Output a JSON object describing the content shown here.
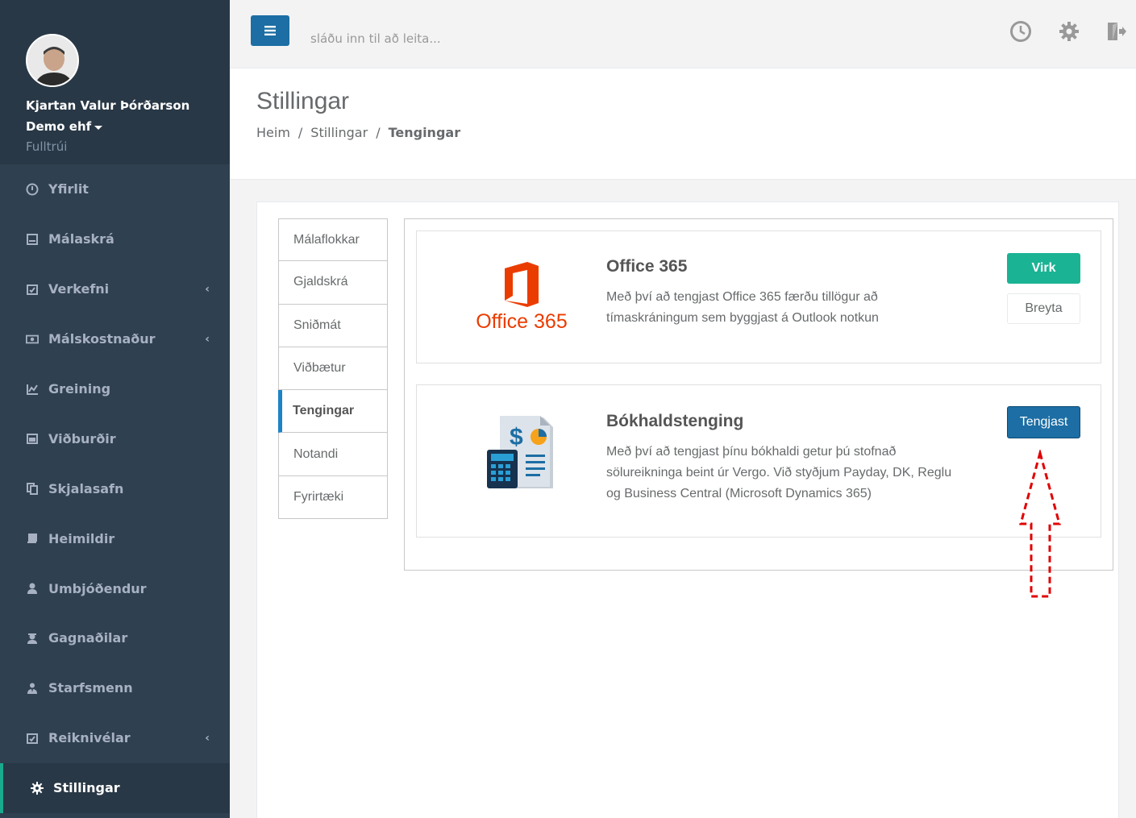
{
  "profile": {
    "name": "Kjartan Valur Þórðarson",
    "company": "Demo ehf",
    "role": "Fulltrúi"
  },
  "sidebar": {
    "items": [
      {
        "label": "Yfirlit",
        "icon": "dashboard-icon",
        "submenu": false
      },
      {
        "label": "Málaskrá",
        "icon": "archive-icon",
        "submenu": false
      },
      {
        "label": "Verkefni",
        "icon": "calendar-check-icon",
        "submenu": true
      },
      {
        "label": "Málskostnaður",
        "icon": "money-icon",
        "submenu": true
      },
      {
        "label": "Greining",
        "icon": "line-chart-icon",
        "submenu": false
      },
      {
        "label": "Viðburðir",
        "icon": "calendar-icon",
        "submenu": false
      },
      {
        "label": "Skjalasafn",
        "icon": "files-icon",
        "submenu": false
      },
      {
        "label": "Heimildir",
        "icon": "book-icon",
        "submenu": false
      },
      {
        "label": "Umbjóðendur",
        "icon": "user-icon",
        "submenu": false
      },
      {
        "label": "Gagnaðilar",
        "icon": "user-secret-icon",
        "submenu": false
      },
      {
        "label": "Starfsmenn",
        "icon": "user-tie-icon",
        "submenu": false
      },
      {
        "label": "Reiknivélar",
        "icon": "calendar-check-icon",
        "submenu": true
      },
      {
        "label": "Stillingar",
        "icon": "gear-icon",
        "submenu": false,
        "active": true
      }
    ]
  },
  "topbar": {
    "search_placeholder": "sláðu inn til að leita..."
  },
  "page": {
    "title": "Stillingar",
    "breadcrumb": [
      "Heim",
      "Stillingar",
      "Tengingar"
    ]
  },
  "tabs": [
    "Málaflokkar",
    "Gjaldskrá",
    "Sniðmát",
    "Viðbætur",
    "Tengingar",
    "Notandi",
    "Fyrirtæki"
  ],
  "active_tab": "Tengingar",
  "integrations": {
    "office": {
      "logo_text": "Office 365",
      "title": "Office 365",
      "description": "Með því að tengjast Office 365 færðu tillögur að tímaskráningum sem byggjast á Outlook notkun",
      "status_label": "Virk",
      "edit_label": "Breyta"
    },
    "accounting": {
      "title": "Bókhaldstenging",
      "description": "Með því að tengjast þínu bókhaldi getur þú stofnað sölureikninga beint úr Vergo. Við styðjum Payday, DK, Reglu og Business Central (Microsoft Dynamics 365)",
      "connect_label": "Tengjast"
    }
  },
  "colors": {
    "sidebar_bg": "#2f4050",
    "primary": "#1c6ea4",
    "success": "#1ab394",
    "office_red": "#eb3c00"
  }
}
